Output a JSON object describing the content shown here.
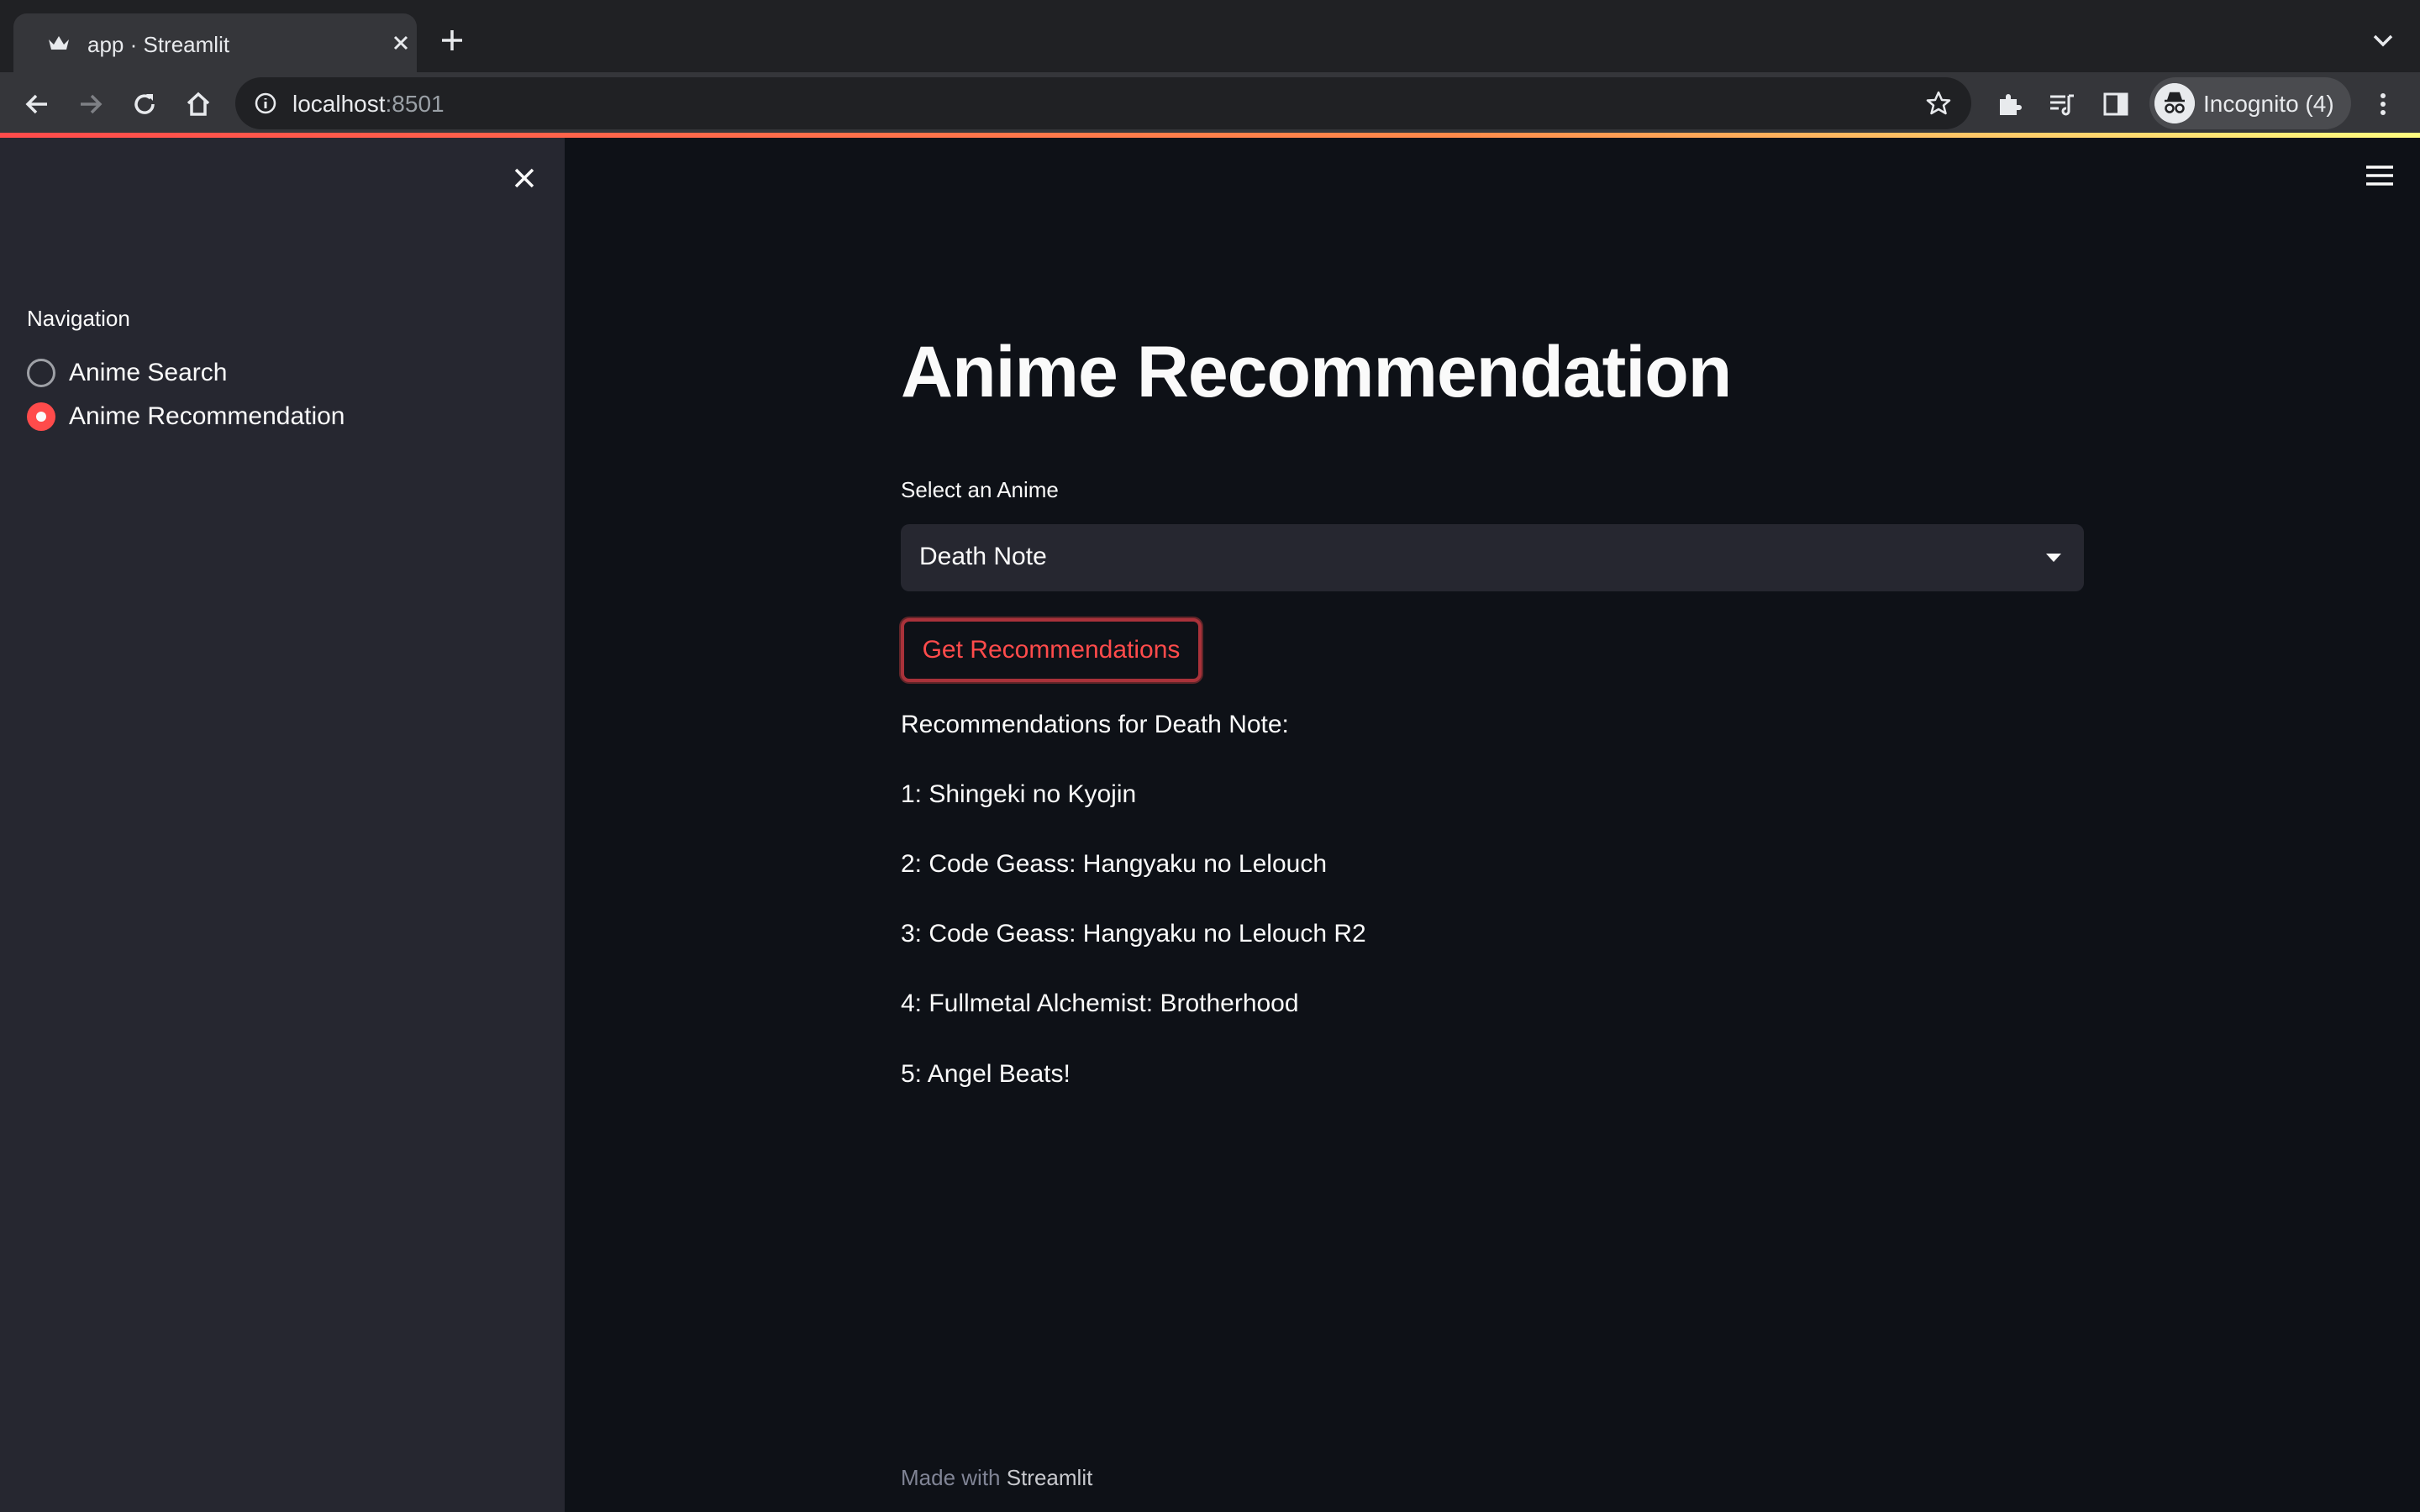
{
  "browser": {
    "tab_title": "app · Streamlit",
    "url_host": "localhost",
    "url_port": ":8501",
    "profile_label": "Incognito (4)"
  },
  "sidebar": {
    "heading": "Navigation",
    "items": [
      {
        "label": "Anime Search",
        "selected": false
      },
      {
        "label": "Anime Recommendation",
        "selected": true
      }
    ]
  },
  "main": {
    "title": "Anime Recommendation",
    "select_label": "Select an Anime",
    "select_value": "Death Note",
    "button_label": "Get Recommendations",
    "results_heading": "Recommendations for Death Note:",
    "results": [
      "1: Shingeki no Kyojin",
      "2: Code Geass: Hangyaku no Lelouch",
      "3: Code Geass: Hangyaku no Lelouch R2",
      "4: Fullmetal Alchemist: Brotherhood",
      "5: Angel Beats!"
    ]
  },
  "footer": {
    "prefix": "Made with ",
    "brand": "Streamlit"
  },
  "colors": {
    "accent": "#ff4b4b",
    "background": "#0e1117",
    "sidebar": "#262730"
  }
}
